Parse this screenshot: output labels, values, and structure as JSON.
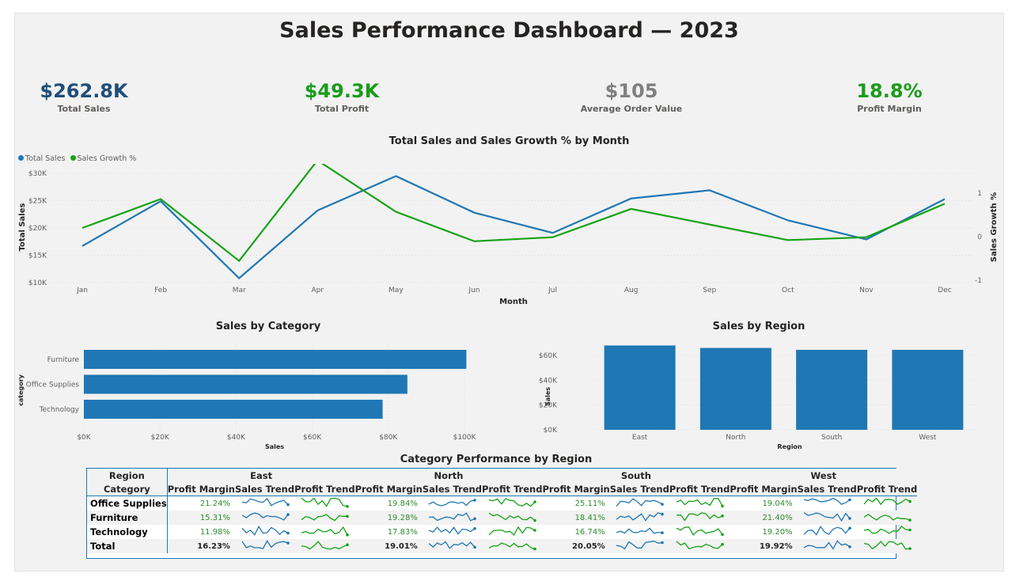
{
  "title": "Sales Performance Dashboard — 2023",
  "kpis": [
    {
      "value": "$262.8K",
      "label": "Total Sales",
      "color": "#1f4e79"
    },
    {
      "value": "$49.3K",
      "label": "Total Profit",
      "color": "#1a9c1a"
    },
    {
      "value": "$105",
      "label": "Average Order Value",
      "color": "#808080"
    },
    {
      "value": "18.8%",
      "label": "Profit Margin",
      "color": "#1a9c1a"
    }
  ],
  "colors": {
    "blue": "#1f77b4",
    "green": "#17a317"
  },
  "chart_data": [
    {
      "type": "line",
      "title": "Total Sales and Sales Growth % by Month",
      "xlabel": "Month",
      "ylabel": "Total Sales",
      "y2label": "Sales Growth %",
      "x": [
        "Jan",
        "Feb",
        "Mar",
        "Apr",
        "May",
        "Jun",
        "Jul",
        "Aug",
        "Sep",
        "Oct",
        "Nov",
        "Dec"
      ],
      "ylim": [
        10000,
        30000
      ],
      "yticks": [
        "$10K",
        "$15K",
        "$20K",
        "$25K",
        "$30K"
      ],
      "y2lim": [
        -1,
        1
      ],
      "y2ticks": [
        "-1",
        "0",
        "1"
      ],
      "legend_position": "top-left",
      "series": [
        {
          "name": "Total Sales",
          "axis": "left",
          "color": "#1f77b4",
          "values": [
            16700,
            24900,
            10800,
            23200,
            29500,
            22800,
            19100,
            25400,
            26900,
            21400,
            17900,
            25300
          ]
        },
        {
          "name": "Sales Growth %",
          "axis": "right",
          "color": "#17a317",
          "values": [
            0.0,
            0.5,
            -0.57,
            1.17,
            0.28,
            -0.23,
            -0.16,
            0.33,
            0.06,
            -0.21,
            -0.16,
            0.42
          ]
        }
      ]
    },
    {
      "type": "bar",
      "orientation": "horizontal",
      "title": "Sales by Category",
      "xlabel": "Sales",
      "ylabel": "category",
      "categories": [
        "Furniture",
        "Office Supplies",
        "Technology"
      ],
      "values": [
        100500,
        85000,
        78500
      ],
      "xlim": [
        0,
        100000
      ],
      "xticks": [
        "$0K",
        "$20K",
        "$40K",
        "$60K",
        "$80K",
        "$100K"
      ],
      "color": "#1f77b4"
    },
    {
      "type": "bar",
      "title": "Sales by Region",
      "xlabel": "Region",
      "ylabel": "Sales",
      "categories": [
        "East",
        "North",
        "South",
        "West"
      ],
      "values": [
        68000,
        66000,
        64500,
        64500
      ],
      "ylim": [
        0,
        60000
      ],
      "yticks": [
        "$0K",
        "$20K",
        "$40K",
        "$60K"
      ],
      "color": "#1f77b4"
    }
  ],
  "table": {
    "title": "Category Performance by Region",
    "corner_top": "Region",
    "corner_bottom": "Category",
    "regions": [
      "East",
      "North",
      "South",
      "West"
    ],
    "subheaders": [
      "Profit Margin",
      "Sales Trend",
      "Profit Trend"
    ],
    "rows": [
      {
        "category": "Office Supplies",
        "margins": [
          "21.24%",
          "19.84%",
          "25.11%",
          "19.04%"
        ]
      },
      {
        "category": "Furniture",
        "margins": [
          "15.31%",
          "19.28%",
          "18.41%",
          "21.40%"
        ]
      },
      {
        "category": "Technology",
        "margins": [
          "11.98%",
          "17.83%",
          "16.74%",
          "19.20%"
        ]
      },
      {
        "category": "Total",
        "margins": [
          "16.23%",
          "19.01%",
          "20.05%",
          "19.92%"
        ]
      }
    ]
  }
}
